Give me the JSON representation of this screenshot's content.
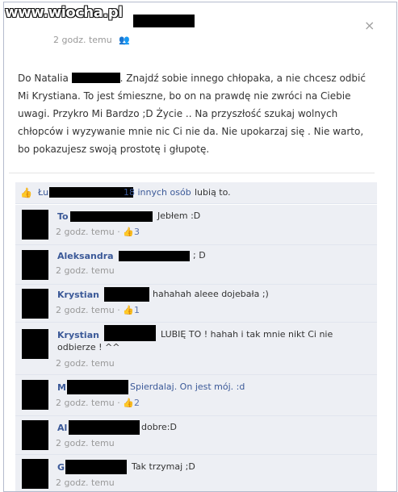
{
  "watermark": "www.wiocha.pl",
  "post": {
    "time": "2 godz. temu",
    "audience_icon": "people-icon",
    "close_label": "×",
    "text_1": "Do Natalia",
    "text_2": ". Znajdź sobie innego chłopaka, a nie chcesz odbić Mi Krystiana. To jest śmieszne, bo on na prawdę nie zwróci na Ciebie uwagi. Przykro Mi Bardzo ;D Życie .. Na przyszłość szukaj wolnych chłopców i wyzywanie mnie nic Ci nie da. Nie upokarzaj się . Nie warto, bo pokazujesz swoją prostotę i głupotę."
  },
  "likes": {
    "prefix": "Łu",
    "others": "18 innych osób",
    "suffix": "lubią to."
  },
  "comments": [
    {
      "author": "To",
      "text": "Jebłem :D",
      "time": "2 godz. temu",
      "likes": "3"
    },
    {
      "author": "Aleksandra",
      "text": "; D",
      "time": "2 godz. temu",
      "likes": ""
    },
    {
      "author": "Krystian",
      "text": "hahahah aleee dojebała ;)",
      "time": "2 godz. temu",
      "likes": "1"
    },
    {
      "author": "Krystian",
      "text": "LUBIĘ TO ! hahah i tak mnie nikt Ci nie odbierze ! ^^",
      "time": "2 godz. temu",
      "likes": ""
    },
    {
      "author": "M",
      "text": "Spierdalaj. On jest mój. :d",
      "time": "2 godz. temu",
      "likes": "2"
    },
    {
      "author": "Al",
      "text": "dobre:D",
      "time": "2 godz. temu",
      "likes": ""
    },
    {
      "author": "G",
      "text": "Tak trzymaj ;D",
      "time": "2 godz. temu",
      "likes": ""
    }
  ],
  "ui": {
    "dot": "·",
    "like_glyph": "👍"
  },
  "colors": {
    "link": "#3b5998",
    "comment_bg": "#edeff4",
    "meta": "#999999"
  }
}
